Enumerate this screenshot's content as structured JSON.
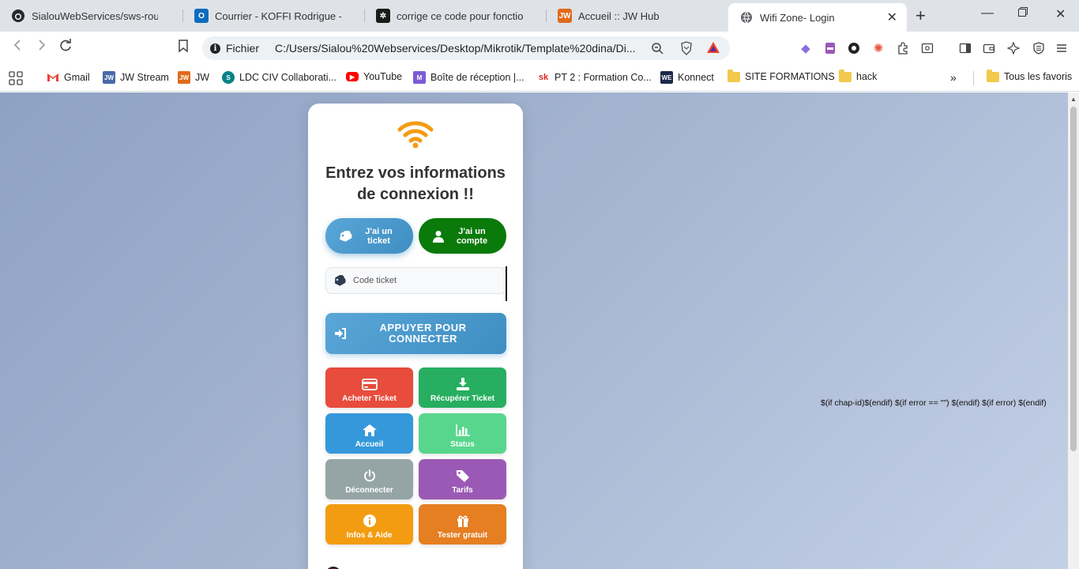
{
  "browser": {
    "tabs": [
      {
        "title": "SialouWebServices/sws-routeros-",
        "icon": "github-icon"
      },
      {
        "title": "Courrier - KOFFI Rodrigue - Outlo",
        "icon": "outlook-icon"
      },
      {
        "title": "corrige ce code pour fonctionnel",
        "icon": "chatgpt-icon"
      },
      {
        "title": "Accueil :: JW Hub",
        "icon": "jw-icon"
      },
      {
        "title": "Wifi Zone- Login",
        "icon": "globe-icon",
        "active": true
      }
    ],
    "address": {
      "scheme_label": "Fichier",
      "url": "C:/Users/Sialou%20Webservices/Desktop/Mikrotik/Template%20dina/Di..."
    },
    "bookmarks": [
      {
        "label": "Gmail",
        "icon": "gmail-icon"
      },
      {
        "label": "JW Stream",
        "icon": "jw-stream-icon"
      },
      {
        "label": "JW",
        "icon": "jw-icon"
      },
      {
        "label": "LDC CIV Collaborati...",
        "icon": "sharepoint-icon"
      },
      {
        "label": "YouTube",
        "icon": "youtube-icon"
      },
      {
        "label": "Boîte de réception |...",
        "icon": "mail-icon"
      },
      {
        "label": "PT 2 : Formation Co...",
        "icon": "sk-icon"
      },
      {
        "label": "Konnect",
        "icon": "konnect-icon"
      },
      {
        "label": "SITE FORMATIONS",
        "icon": "folder-icon"
      },
      {
        "label": "hack",
        "icon": "folder-icon"
      }
    ],
    "all_bookmarks": "Tous les favoris"
  },
  "login": {
    "heading": "Entrez vos informations de connexion !!",
    "ticket_mode": "J'ai un ticket",
    "account_mode": "J'ai un compte",
    "code_placeholder": "Code ticket",
    "connect_label": "APPUYER POUR CONNECTER",
    "grid": [
      {
        "label": "Acheter Ticket",
        "icon": "credit-card-icon",
        "color": "#e74c3c"
      },
      {
        "label": "Récupérer Ticket",
        "icon": "download-icon",
        "color": "#27ae60"
      },
      {
        "label": "Accueil",
        "icon": "home-icon",
        "color": "#3498db"
      },
      {
        "label": "Status",
        "icon": "bar-chart-icon",
        "color": "#58d68d"
      },
      {
        "label": "Déconnecter",
        "icon": "power-icon",
        "color": "#95a5a6"
      },
      {
        "label": "Tarifs",
        "icon": "tags-icon",
        "color": "#9b59b6"
      },
      {
        "label": "Infos & Aide",
        "icon": "info-icon",
        "color": "#f39c12"
      },
      {
        "label": "Tester gratuit",
        "icon": "gift-icon",
        "color": "#e67e22"
      }
    ],
    "accent_color": "#3e8ec2",
    "wifi_color": "#f39c12"
  },
  "template_text": "$(if chap-id)$(endif) $(if error == \"\") $(endif) $(if error) $(endif)"
}
